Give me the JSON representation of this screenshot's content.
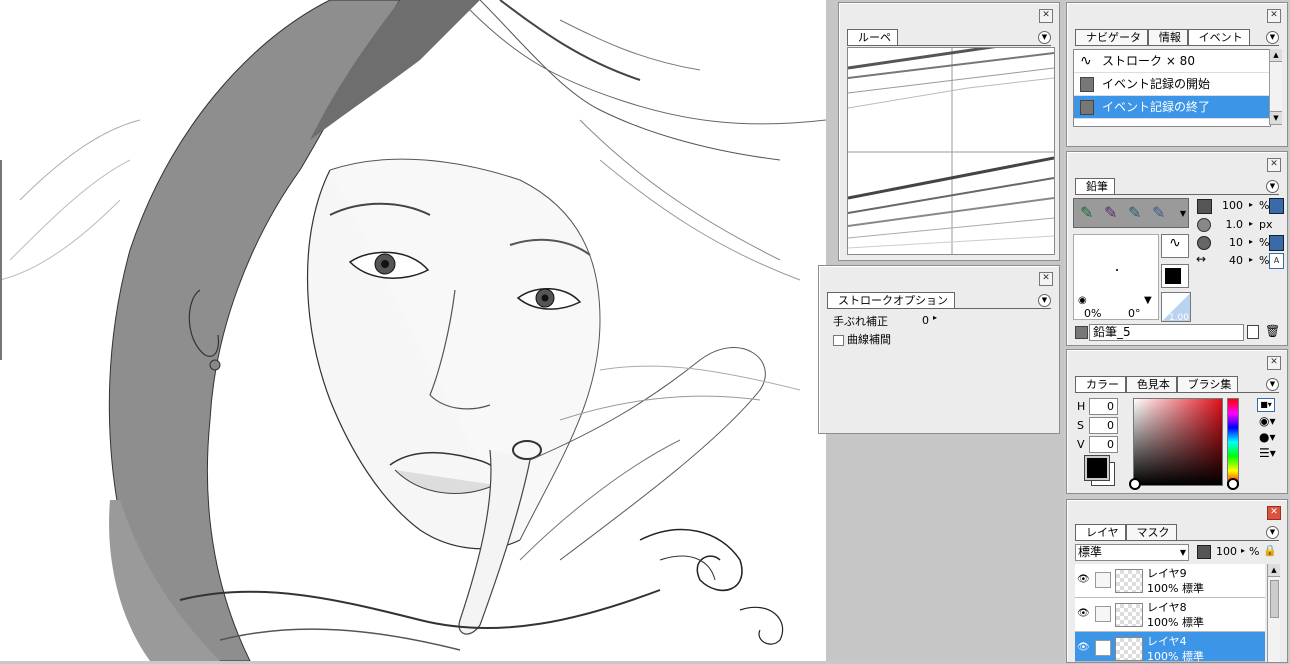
{
  "loupe_panel": {
    "tab": "ルーペ"
  },
  "stroke_panel": {
    "tab": "ストロークオプション",
    "stabilizer_label": "手ぶれ補正",
    "stabilizer_value": "0",
    "curve_label": "曲線補間"
  },
  "history_panel": {
    "tabs": [
      "ナビゲータ",
      "情報",
      "イベント"
    ],
    "items": [
      {
        "label": "ストローク × 80",
        "icon": "stroke-icon"
      },
      {
        "label": "イベント記録の開始",
        "icon": "record-start-icon"
      },
      {
        "label": "イベント記録の終了",
        "icon": "record-end-icon",
        "selected": true
      }
    ]
  },
  "pencil_panel": {
    "tab": "鉛筆",
    "opacity": "100",
    "opacity_unit": "%",
    "size": "1.0",
    "size_unit": "px",
    "flow": "10",
    "flow_unit": "%",
    "spacing": "40",
    "spacing_unit": "%",
    "preview_angle_pct": "0%",
    "preview_angle_deg": "0°",
    "pressure_value": "1.00",
    "preset_name": "鉛筆_5"
  },
  "color_panel": {
    "tabs": [
      "カラー",
      "色見本",
      "ブラシ集"
    ],
    "h_label": "H",
    "h_value": "0",
    "s_label": "S",
    "s_value": "0",
    "v_label": "V",
    "v_value": "0",
    "foreground": "#000000",
    "background": "#ffffff"
  },
  "layer_panel": {
    "tabs": [
      "レイヤ",
      "マスク"
    ],
    "blend_mode": "標準",
    "opacity": "100",
    "opacity_unit": "%",
    "layers": [
      {
        "name": "レイヤ9",
        "mode": "100% 標準",
        "selected": false
      },
      {
        "name": "レイヤ8",
        "mode": "100% 標準",
        "selected": false
      },
      {
        "name": "レイヤ4",
        "mode": "100% 標準",
        "selected": true
      }
    ]
  },
  "colors": {
    "selection": "#3d95e8",
    "panel_bg": "#ececec",
    "workspace": "#c6c6c6"
  }
}
